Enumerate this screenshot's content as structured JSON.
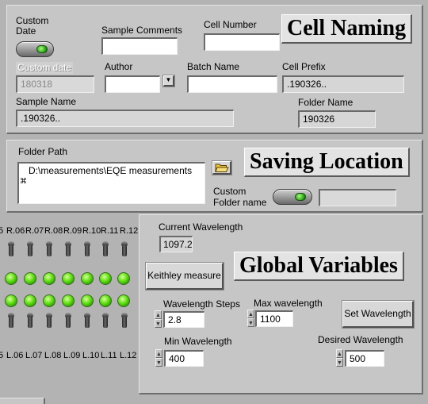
{
  "cell_naming": {
    "custom_date_label": "Custom Date",
    "sample_comments_label": "Sample Comments",
    "sample_comments_value": "",
    "cell_number_label": "Cell Number",
    "cell_number_value": "",
    "title": "Cell Naming",
    "custom_date_field_label": "Custom date",
    "custom_date_value": "180318",
    "author_label": "Author",
    "author_value": "",
    "batch_name_label": "Batch Name",
    "batch_name_value": "",
    "cell_prefix_label": "Cell Prefix",
    "cell_prefix_value": ".190326..",
    "sample_name_label": "Sample Name",
    "sample_name_value": ".190326..",
    "folder_name_label": "Folder Name",
    "folder_name_value": "190326"
  },
  "saving_location": {
    "folder_path_label": "Folder Path",
    "folder_path_value": "D:\\measurements\\EQE measurements",
    "title": "Saving Location",
    "custom_folder_label": "Custom Folder name",
    "custom_folder_value": ""
  },
  "channels": {
    "top_labels": [
      "5",
      "R.06",
      "R.07",
      "R.08",
      "R.09",
      "R.10",
      "R.11",
      "R.12"
    ],
    "bottom_labels": [
      "5",
      "L.06",
      "L.07",
      "L.08",
      "L.09",
      "L.10",
      "L.11",
      "L.12"
    ],
    "led_color": "#5fe012"
  },
  "global_variables": {
    "title": "Global Variables",
    "current_wavelength_label": "Current Wavelength",
    "current_wavelength_value": "1097.2",
    "keithley_button": "Keithley measure",
    "wavelength_steps_label": "Wavelength Steps",
    "wavelength_steps_value": "2.8",
    "max_wavelength_label": "Max wavelength",
    "max_wavelength_value": "1100",
    "set_wavelength_button": "Set Wavelength",
    "min_wavelength_label": "Min Wavelength",
    "min_wavelength_value": "400",
    "desired_wavelength_label": "Desired Wavelength",
    "desired_wavelength_value": "500"
  },
  "icons": {
    "folder_browse": "folder-open-icon",
    "dropdown": "chevron-down-icon",
    "spinner_up": "triangle-up",
    "spinner_down": "triangle-down"
  }
}
